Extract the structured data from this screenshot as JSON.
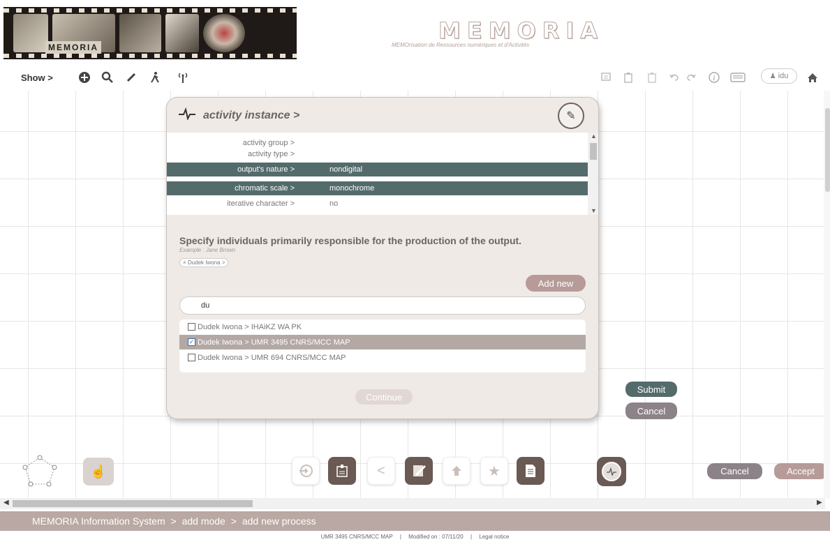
{
  "header": {
    "film_logo": "MEMORIA",
    "title": "MEMORIA",
    "subtitle": "MEMOrisation de Ressources numériques et d'Activités"
  },
  "toolbar": {
    "show_label": "Show >",
    "user_label": "idu",
    "icons_left": [
      "add-icon",
      "search-icon",
      "pen-icon",
      "hiker-icon",
      "antenna-icon"
    ],
    "icons_right": [
      "comment-icon",
      "paste-icon",
      "paste-disabled-icon",
      "undo-icon",
      "redo-icon",
      "info-icon",
      "keyboard-icon",
      "user-icon",
      "home-icon"
    ]
  },
  "dialog": {
    "title": "activity instance >",
    "properties": [
      {
        "key": "activity group >",
        "value": "",
        "selected": false
      },
      {
        "key": "activity type >",
        "value": "",
        "selected": false
      },
      {
        "key": "output's nature >",
        "value": "nondigital",
        "selected": true
      },
      {
        "key": "chromatic scale >",
        "value": "monochrome",
        "selected": true
      },
      {
        "key": "iterative character >",
        "value": "no",
        "selected": false
      }
    ],
    "instruction": "Specify individuals primarily responsible for the production of the output.",
    "example": "Example : Jane Brown",
    "selected_tag": "× Dudek Iwona >",
    "add_new_label": "Add new",
    "search_value": "du",
    "results": [
      {
        "label": "Dudek Iwona > IHAiKZ WA PK",
        "checked": false
      },
      {
        "label": "Dudek Iwona > UMR 3495 CNRS/MCC MAP",
        "checked": true
      },
      {
        "label": "Dudek Iwona > UMR 694 CNRS/MCC MAP",
        "checked": false
      }
    ],
    "continue_label": "Continue"
  },
  "side_buttons": {
    "submit": "Submit",
    "cancel": "Cancel"
  },
  "bottom": {
    "back_symbol": "<",
    "cancel": "Cancel",
    "accept": "Accept"
  },
  "status_bar": {
    "items": [
      "MEMORIA  Information System",
      ">",
      "add mode",
      ">",
      "add new process"
    ]
  },
  "footer": {
    "lab": "UMR 3495 CNRS/MCC MAP",
    "modified": "Modified on : 07/11/20",
    "legal": "Legal notice",
    "separator": "|"
  },
  "colors": {
    "accent_dark": "#546b6c",
    "accent_rose": "#b69b98",
    "accent_grey": "#8c8389",
    "status_bar": "#b9a8a3"
  }
}
